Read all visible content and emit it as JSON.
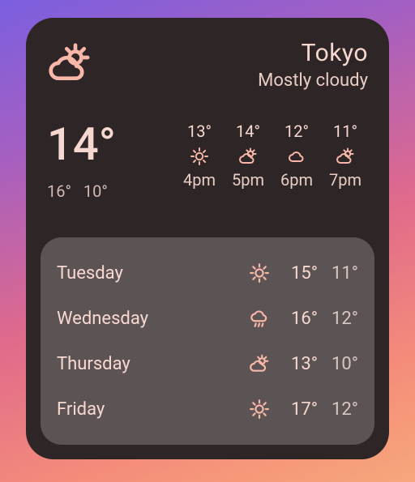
{
  "location": "Tokyo",
  "condition": "Mostly cloudy",
  "current_icon": "partly-cloudy",
  "current_temp": "14°",
  "today_high": "16°",
  "today_low": "10°",
  "hourly": [
    {
      "temp": "13°",
      "icon": "sunny",
      "time": "4pm"
    },
    {
      "temp": "14°",
      "icon": "partly-cloudy",
      "time": "5pm"
    },
    {
      "temp": "12°",
      "icon": "cloudy",
      "time": "6pm"
    },
    {
      "temp": "11°",
      "icon": "partly-cloudy",
      "time": "7pm"
    }
  ],
  "daily": [
    {
      "day": "Tuesday",
      "icon": "sunny",
      "high": "15°",
      "low": "11°"
    },
    {
      "day": "Wednesday",
      "icon": "rain",
      "high": "16°",
      "low": "12°"
    },
    {
      "day": "Thursday",
      "icon": "partly-cloudy",
      "high": "13°",
      "low": "10°"
    },
    {
      "day": "Friday",
      "icon": "sunny",
      "high": "17°",
      "low": "12°"
    }
  ],
  "icons": {
    "sunny": "sunny-icon",
    "partly-cloudy": "partly-cloudy-icon",
    "cloudy": "cloudy-icon",
    "rain": "rain-icon"
  }
}
